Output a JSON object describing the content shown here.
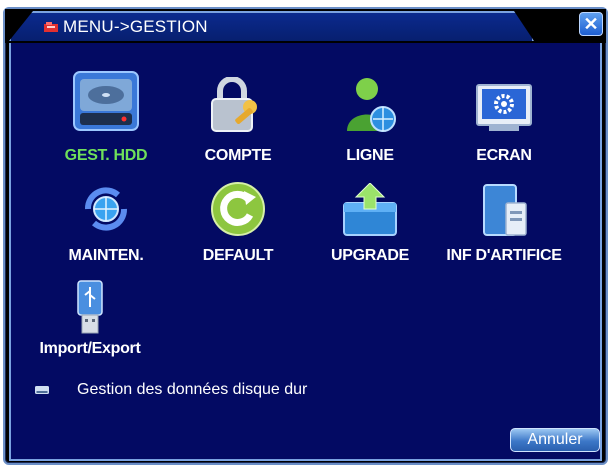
{
  "window": {
    "title": "MENU->GESTION",
    "close_symbol": "✕"
  },
  "menu": {
    "items": [
      {
        "label": "GEST. HDD",
        "icon": "hdd-icon",
        "selected": true
      },
      {
        "label": "COMPTE",
        "icon": "padlock-key-icon"
      },
      {
        "label": "LIGNE",
        "icon": "user-globe-icon"
      },
      {
        "label": "ECRAN",
        "icon": "monitor-gear-icon"
      },
      {
        "label": "MAINTEN.",
        "icon": "globe-refresh-icon"
      },
      {
        "label": "DEFAULT",
        "icon": "reset-icon"
      },
      {
        "label": "UPGRADE",
        "icon": "upgrade-arrow-icon"
      },
      {
        "label": "INF D'ARTIFICE",
        "icon": "device-info-icon"
      },
      {
        "label": "Import/Export",
        "icon": "usb-drive-icon"
      }
    ]
  },
  "status": {
    "text": "Gestion des données disque dur",
    "icon": "hdd-small-icon"
  },
  "buttons": {
    "cancel_label": "Annuler"
  },
  "colors": {
    "panel_bg": "#030a63",
    "selected_label": "#6fe05a",
    "label": "#ffffff"
  }
}
